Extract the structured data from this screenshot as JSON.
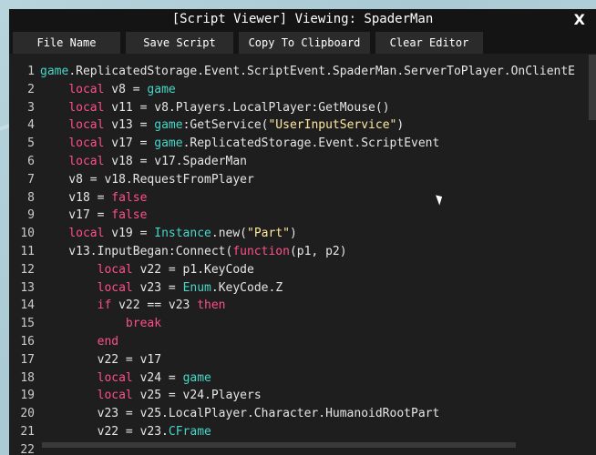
{
  "window": {
    "title": "[Script Viewer] Viewing: SpaderMan",
    "close_label": "X"
  },
  "menu": {
    "file_name": "File Name",
    "save_script": "Save Script",
    "copy_clipboard": "Copy To Clipboard",
    "clear_editor": "Clear Editor"
  },
  "code_lines": [
    {
      "n": "1",
      "tokens": [
        [
          "g",
          "game"
        ],
        [
          "p",
          ".ReplicatedStorage.Event.ScriptEvent.SpaderMan.ServerToPlayer.OnClientE"
        ]
      ]
    },
    {
      "n": "2",
      "tokens": [
        [
          "p",
          "    "
        ],
        [
          "k",
          "local"
        ],
        [
          "p",
          " v8 = "
        ],
        [
          "g",
          "game"
        ]
      ]
    },
    {
      "n": "3",
      "tokens": [
        [
          "p",
          "    "
        ],
        [
          "k",
          "local"
        ],
        [
          "p",
          " v11 = v8.Players.LocalPlayer:GetMouse()"
        ]
      ]
    },
    {
      "n": "4",
      "tokens": [
        [
          "p",
          "    "
        ],
        [
          "k",
          "local"
        ],
        [
          "p",
          " v13 = "
        ],
        [
          "g",
          "game"
        ],
        [
          "p",
          ":GetService("
        ],
        [
          "s",
          "\"UserInputService\""
        ],
        [
          "p",
          ")"
        ]
      ]
    },
    {
      "n": "5",
      "tokens": [
        [
          "p",
          "    "
        ],
        [
          "k",
          "local"
        ],
        [
          "p",
          " v17 = "
        ],
        [
          "g",
          "game"
        ],
        [
          "p",
          ".ReplicatedStorage.Event.ScriptEvent"
        ]
      ]
    },
    {
      "n": "6",
      "tokens": [
        [
          "p",
          "    "
        ],
        [
          "k",
          "local"
        ],
        [
          "p",
          " v18 = v17.SpaderMan"
        ]
      ]
    },
    {
      "n": "7",
      "tokens": [
        [
          "p",
          "    v8 = v18.RequestFromPlayer"
        ]
      ]
    },
    {
      "n": "8",
      "tokens": [
        [
          "p",
          "    v18 = "
        ],
        [
          "k",
          "false"
        ]
      ]
    },
    {
      "n": "9",
      "tokens": [
        [
          "p",
          "    v17 = "
        ],
        [
          "k",
          "false"
        ]
      ]
    },
    {
      "n": "10",
      "tokens": [
        [
          "p",
          "    "
        ],
        [
          "k",
          "local"
        ],
        [
          "p",
          " v19 = "
        ],
        [
          "g",
          "Instance"
        ],
        [
          "p",
          ".new("
        ],
        [
          "s",
          "\"Part\""
        ],
        [
          "p",
          ")"
        ]
      ]
    },
    {
      "n": "11",
      "tokens": [
        [
          "p",
          "    v13.InputBegan:Connect("
        ],
        [
          "k",
          "function"
        ],
        [
          "p",
          "(p1, p2)"
        ]
      ]
    },
    {
      "n": "12",
      "tokens": [
        [
          "p",
          "        "
        ],
        [
          "k",
          "local"
        ],
        [
          "p",
          " v22 = p1.KeyCode"
        ]
      ]
    },
    {
      "n": "13",
      "tokens": [
        [
          "p",
          "        "
        ],
        [
          "k",
          "local"
        ],
        [
          "p",
          " v23 = "
        ],
        [
          "g",
          "Enum"
        ],
        [
          "p",
          ".KeyCode.Z"
        ]
      ]
    },
    {
      "n": "14",
      "tokens": [
        [
          "p",
          "        "
        ],
        [
          "k",
          "if"
        ],
        [
          "p",
          " v22 == v23 "
        ],
        [
          "k",
          "then"
        ]
      ]
    },
    {
      "n": "15",
      "tokens": [
        [
          "p",
          "            "
        ],
        [
          "k",
          "break"
        ]
      ]
    },
    {
      "n": "16",
      "tokens": [
        [
          "p",
          "        "
        ],
        [
          "k",
          "end"
        ]
      ]
    },
    {
      "n": "17",
      "tokens": [
        [
          "p",
          "        v22 = v17"
        ]
      ]
    },
    {
      "n": "18",
      "tokens": [
        [
          "p",
          "        "
        ],
        [
          "k",
          "local"
        ],
        [
          "p",
          " v24 = "
        ],
        [
          "g",
          "game"
        ]
      ]
    },
    {
      "n": "19",
      "tokens": [
        [
          "p",
          "        "
        ],
        [
          "k",
          "local"
        ],
        [
          "p",
          " v25 = v24.Players"
        ]
      ]
    },
    {
      "n": "20",
      "tokens": [
        [
          "p",
          "        v23 = v25.LocalPlayer.Character.HumanoidRootPart"
        ]
      ]
    },
    {
      "n": "21",
      "tokens": [
        [
          "p",
          "        v22 = v23."
        ],
        [
          "g",
          "CFrame"
        ]
      ]
    },
    {
      "n": "22",
      "tokens": [
        [
          "p",
          ""
        ]
      ]
    }
  ],
  "colors": {
    "global": "#47d6c8",
    "keyword": "#ff4f8a",
    "string": "#ffe8a0",
    "plain": "#e6e6e6",
    "background": "#1e1e1e",
    "titlebar": "#141414"
  }
}
